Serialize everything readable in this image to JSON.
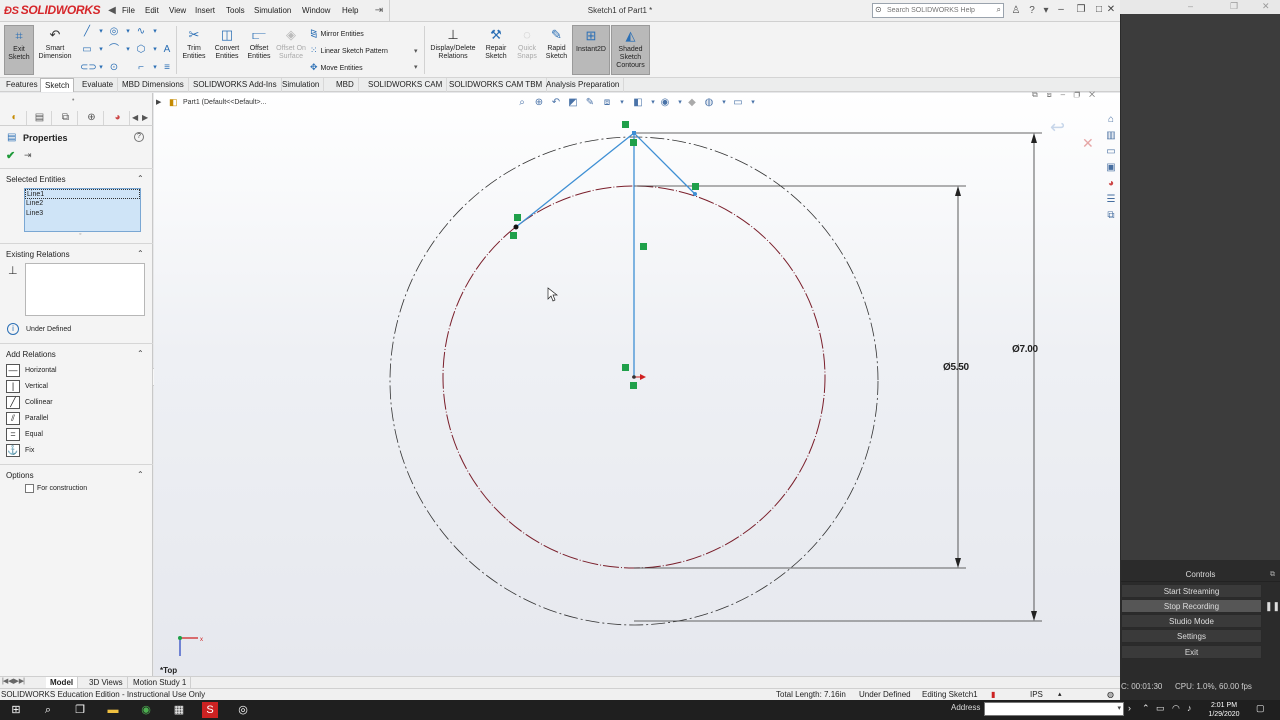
{
  "window": {
    "brand": "SOLIDWORKS",
    "doc_title": "Sketch1 of Part1 *",
    "menus": [
      "File",
      "Edit",
      "View",
      "Insert",
      "Tools",
      "Simulation",
      "Window",
      "Help"
    ],
    "search_placeholder": "Search SOLIDWORKS Help"
  },
  "ribbon": {
    "exit_sketch": "Exit Sketch",
    "smart_dimension": "Smart Dimension",
    "trim_entities": "Trim Entities",
    "convert_entities": "Convert Entities",
    "offset_entities": "Offset Entities",
    "offset_on_surface": "Offset On Surface",
    "mirror_entities": "Mirror Entities",
    "linear_sketch_pattern": "Linear Sketch Pattern",
    "move_entities": "Move Entities",
    "display_delete_relations": "Display/Delete Relations",
    "repair_sketch": "Repair Sketch",
    "quick_snaps": "Quick Snaps",
    "rapid_sketch": "Rapid Sketch",
    "instant2d": "Instant2D",
    "shaded_sketch_contours": "Shaded Sketch Contours"
  },
  "tabs": [
    "Features",
    "Sketch",
    "Evaluate",
    "MBD Dimensions",
    "SOLIDWORKS Add-Ins",
    "Simulation",
    "MBD",
    "SOLIDWORKS CAM",
    "SOLIDWORKS CAM TBM",
    "Analysis Preparation"
  ],
  "property_manager": {
    "title": "Properties",
    "selected_entities_title": "Selected Entities",
    "selected_entities": [
      "Line1",
      "Line2",
      "Line3"
    ],
    "existing_relations_title": "Existing Relations",
    "status": "Under Defined",
    "add_relations_title": "Add Relations",
    "relations": [
      "Horizontal",
      "Vertical",
      "Collinear",
      "Parallel",
      "Equal",
      "Fix"
    ],
    "options_title": "Options",
    "for_construction": "For construction"
  },
  "graphics": {
    "tree_label": "Part1  (Default<<Default>...",
    "view_label": "*Top",
    "dim_outer": "Ø7.00",
    "dim_inner": "Ø5.50"
  },
  "bottom_tabs": [
    "Model",
    "3D Views",
    "Motion Study 1"
  ],
  "statusbar": {
    "edition": "SOLIDWORKS Education Edition - Instructional Use Only",
    "total_length": "Total Length: 7.16in",
    "defined": "Under Defined",
    "editing": "Editing Sketch1",
    "units": "IPS"
  },
  "obs": {
    "controls_title": "Controls",
    "buttons": [
      "Start Streaming",
      "Stop Recording",
      "Studio Mode",
      "Settings",
      "Exit"
    ],
    "timer": "C: 00:01:30",
    "cpu": "CPU: 1.0%, 60.00 fps"
  },
  "taskbar": {
    "address_label": "Address",
    "time": "2:01 PM",
    "date": "1/29/2020"
  },
  "colors": {
    "brand_red": "#d6262a",
    "sketch_blue": "#3e8fd4",
    "relation_green": "#1fa04a",
    "inner_circle": "#7a1e2a"
  }
}
